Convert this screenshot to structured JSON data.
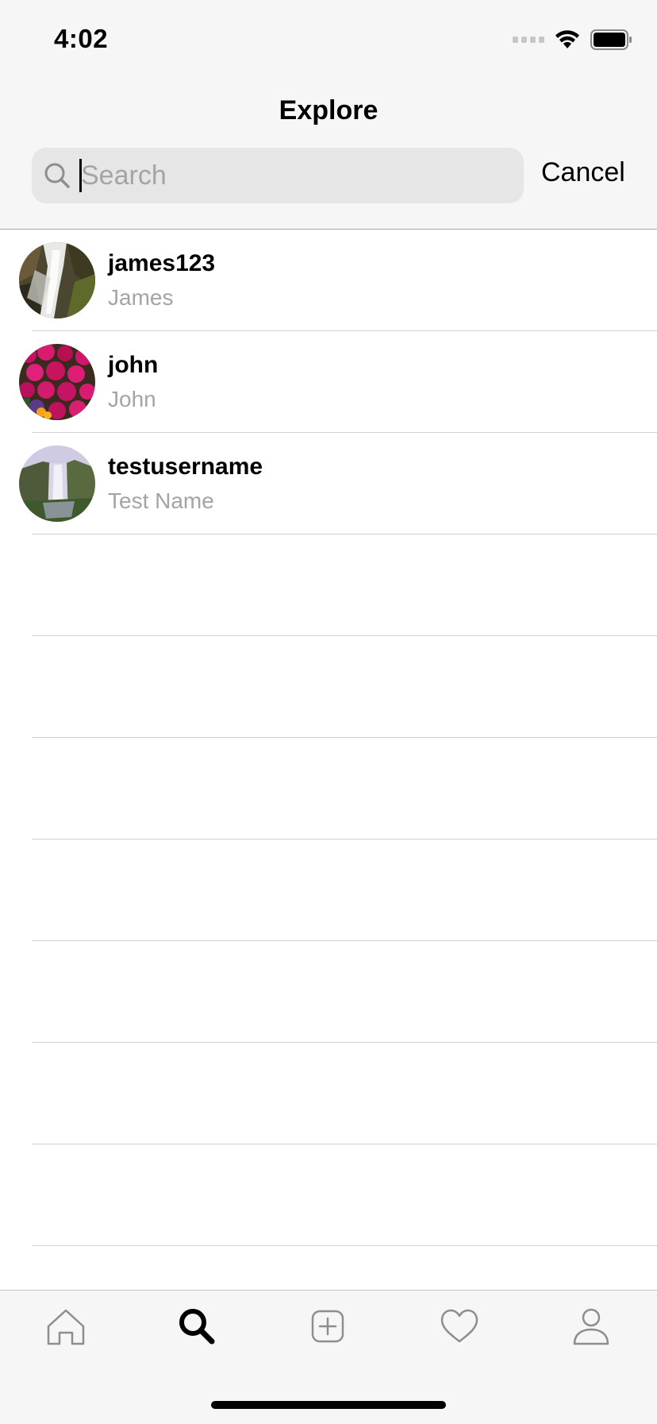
{
  "status_bar": {
    "time": "4:02"
  },
  "nav": {
    "title": "Explore"
  },
  "search": {
    "placeholder": "Search",
    "value": "",
    "cancel_label": "Cancel"
  },
  "results": [
    {
      "username": "james123",
      "name": "James"
    },
    {
      "username": "john",
      "name": "John"
    },
    {
      "username": "testusername",
      "name": "Test Name"
    }
  ],
  "tabs": [
    "home-icon",
    "search-icon",
    "add-post-icon",
    "heart-icon",
    "profile-icon"
  ],
  "selected_tab": "search-icon"
}
